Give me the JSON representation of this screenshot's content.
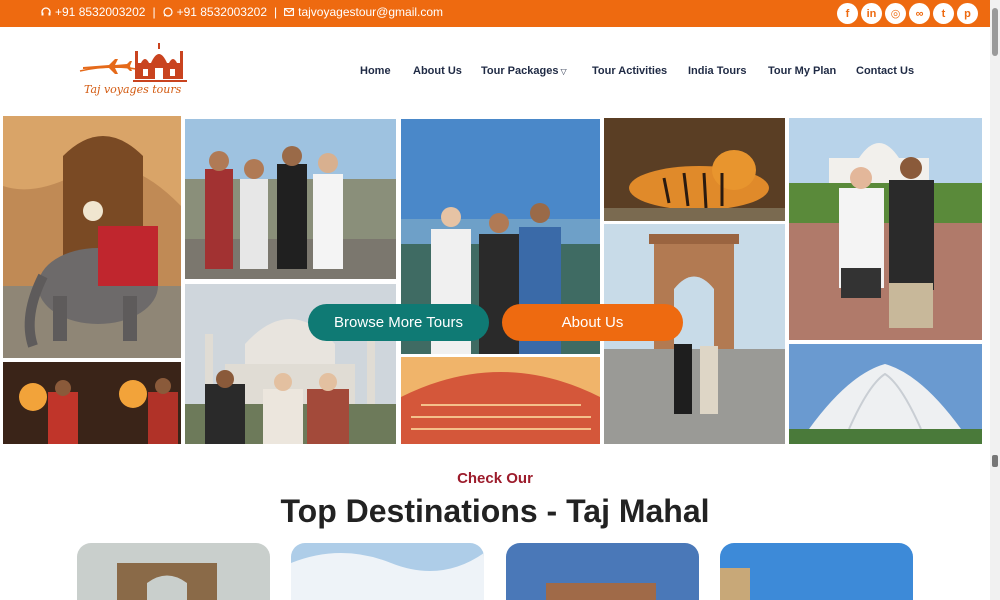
{
  "topbar": {
    "phone_call": "+91 8532003202",
    "phone_whatsapp": "+91 8532003202",
    "email": "tajvoyagestour@gmail.com",
    "separator": "|",
    "socials": [
      {
        "name": "facebook",
        "glyph": "f"
      },
      {
        "name": "linkedin",
        "glyph": "in"
      },
      {
        "name": "instagram",
        "glyph": "◎"
      },
      {
        "name": "tripadvisor",
        "glyph": "∞"
      },
      {
        "name": "twitter",
        "glyph": "t"
      },
      {
        "name": "pinterest",
        "glyph": "p"
      }
    ]
  },
  "header": {
    "logo_text": "Taj voyages tours",
    "nav": [
      {
        "label": "Home"
      },
      {
        "label": "About Us"
      },
      {
        "label": "Tour Packages",
        "has_dropdown": true
      },
      {
        "label": "Tour Activities"
      },
      {
        "label": "India Tours"
      },
      {
        "label": "Tour My Plan"
      },
      {
        "label": "Contact Us"
      }
    ]
  },
  "hero": {
    "browse_button": "Browse More Tours",
    "about_button": "About Us"
  },
  "section": {
    "kicker": "Check Our",
    "title": "Top Destinations - Taj Mahal"
  },
  "colors": {
    "brand_orange": "#ee6a10",
    "brand_teal": "#0f7a74",
    "nav_text": "#1f2a44",
    "kicker": "#9c1b2b"
  }
}
